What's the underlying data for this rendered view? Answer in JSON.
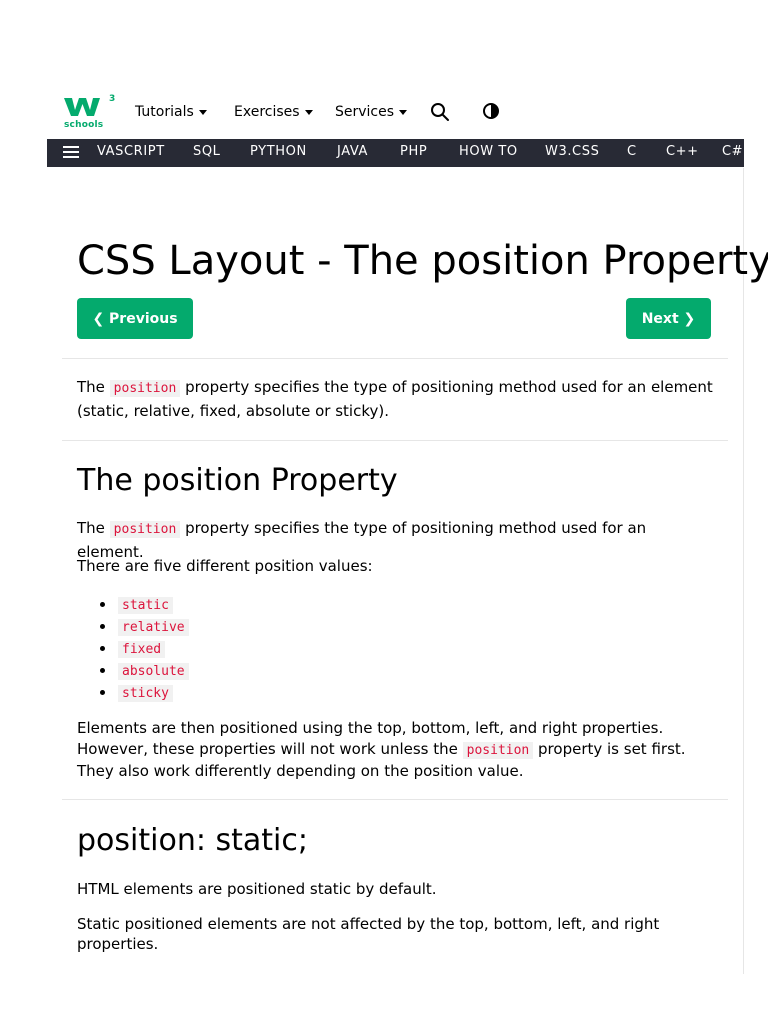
{
  "logo": {
    "text": "w",
    "superscript": "3",
    "subtitle": "schools"
  },
  "topnav": {
    "tutorials": "Tutorials",
    "exercises": "Exercises",
    "services": "Services"
  },
  "subnav": {
    "items": [
      "VASCRIPT",
      "SQL",
      "PYTHON",
      "JAVA",
      "PHP",
      "HOW TO",
      "W3.CSS",
      "C",
      "C++",
      "C#"
    ]
  },
  "page": {
    "title": "CSS Layout - The position Property",
    "prev_label": "Previous",
    "next_label": "Next",
    "intro": {
      "before": "The ",
      "code": "position",
      "after": " property specifies the type of positioning method used for an element (static, relative, fixed, absolute or sticky)."
    },
    "section1": {
      "heading": "The position Property",
      "p1_before": "The ",
      "p1_code": "position",
      "p1_after": " property specifies the type of positioning method used for an element.",
      "p2": "There are five different position values:",
      "values": [
        "static",
        "relative",
        "fixed",
        "absolute",
        "sticky"
      ],
      "p3_before": "Elements are then positioned using the top, bottom, left, and right properties. However, these properties will not work unless the ",
      "p3_code": "position",
      "p3_after": " property is set first. They also work differently depending on the position value."
    },
    "section2": {
      "heading": "position: static;",
      "p1": "HTML elements are positioned static by default.",
      "p2": "Static positioned elements are not affected by the top, bottom, left, and right properties."
    }
  },
  "colors": {
    "accent": "#04aa6d",
    "subnav_bg": "#282a35",
    "code_text": "#dc143c",
    "code_bg": "#f1f1f1"
  }
}
